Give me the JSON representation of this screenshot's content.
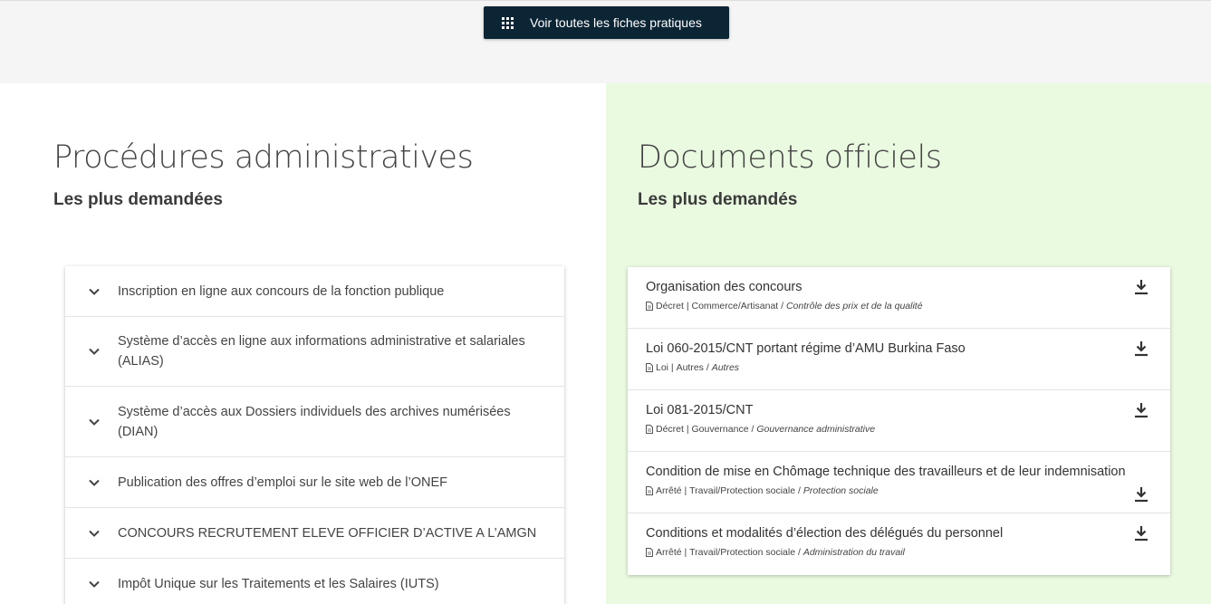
{
  "top": {
    "button_label": "Voir toutes les fiches pratiques"
  },
  "procedures": {
    "title": "Procédures administratives",
    "subtitle": "Les plus demandées",
    "items": [
      "Inscription en ligne aux concours de la fonction publique",
      "Système d’accès en ligne aux informations administrative et salariales (ALIAS)",
      "Système d’accès aux Dossiers individuels des archives numérisées (DIAN)",
      "Publication des offres d’emploi sur le site web de l’ONEF",
      "CONCOURS RECRUTEMENT ELEVE OFFICIER D’ACTIVE A L’AMGN",
      "Impôt Unique sur les Traitements et les Salaires (IUTS)"
    ]
  },
  "documents": {
    "title": "Documents officiels",
    "subtitle": "Les plus demandés",
    "items": [
      {
        "title": "Organisation des concours",
        "type": "Décret",
        "category": "Commerce/Artisanat",
        "topic": "Contrôle des prix et de la qualité"
      },
      {
        "title": "Loi 060-2015/CNT portant régime d’AMU Burkina Faso",
        "type": "Loi",
        "category": "Autres",
        "topic": "Autres"
      },
      {
        "title": "Loi 081-2015/CNT",
        "type": "Décret",
        "category": "Gouvernance",
        "topic": "Gouvernance administrative"
      },
      {
        "title": "Condition de mise en Chômage technique des travailleurs et de leur indemnisation",
        "type": "Arrêté",
        "category": "Travail/Protection sociale",
        "topic": "Protection sociale"
      },
      {
        "title": "Conditions et modalités d’élection des délégués du personnel",
        "type": "Arrêté",
        "category": "Travail/Protection sociale",
        "topic": "Administration du travail"
      }
    ]
  },
  "icons": {
    "button": "grid-icon",
    "accordion": "chevron-down-icon",
    "file": "file-icon",
    "download": "download-icon"
  },
  "colors": {
    "button_bg": "#0c2535",
    "right_bg": "#eafae1",
    "top_band": "#f5f5f5"
  }
}
